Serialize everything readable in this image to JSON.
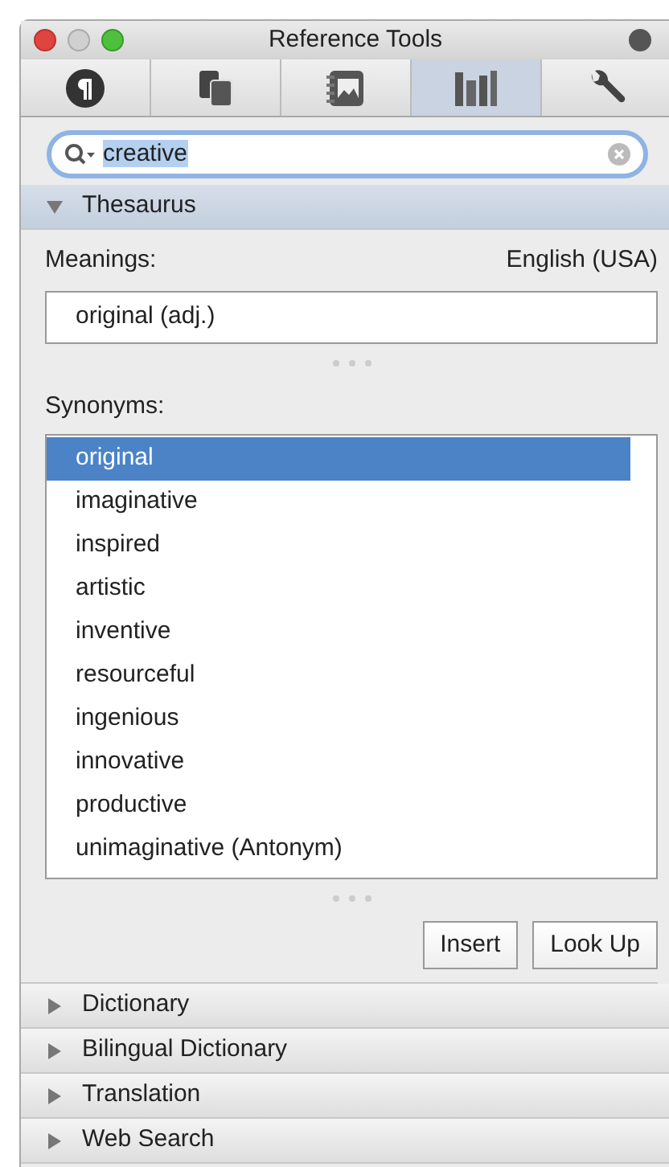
{
  "window": {
    "title": "Reference Tools"
  },
  "tabs": [
    {
      "kind": "paragraph",
      "selected": false
    },
    {
      "kind": "documents",
      "selected": false
    },
    {
      "kind": "media",
      "selected": false
    },
    {
      "kind": "library",
      "selected": true
    },
    {
      "kind": "tools",
      "selected": false
    }
  ],
  "search": {
    "value": "creative"
  },
  "sections": [
    {
      "title": "Thesaurus",
      "expanded": true
    },
    {
      "title": "Dictionary",
      "expanded": false
    },
    {
      "title": "Bilingual Dictionary",
      "expanded": false
    },
    {
      "title": "Translation",
      "expanded": false
    },
    {
      "title": "Web Search",
      "expanded": false
    }
  ],
  "thesaurus": {
    "meanings_label": "Meanings:",
    "language": "English (USA)",
    "meanings": [
      {
        "text": "original (adj.)",
        "selected": false
      }
    ],
    "synonyms_label": "Synonyms:",
    "synonyms": [
      {
        "text": "original",
        "selected": true
      },
      {
        "text": "imaginative",
        "selected": false
      },
      {
        "text": "inspired",
        "selected": false
      },
      {
        "text": "artistic",
        "selected": false
      },
      {
        "text": "inventive",
        "selected": false
      },
      {
        "text": "resourceful",
        "selected": false
      },
      {
        "text": "ingenious",
        "selected": false
      },
      {
        "text": "innovative",
        "selected": false
      },
      {
        "text": "productive",
        "selected": false
      },
      {
        "text": "unimaginative (Antonym)",
        "selected": false
      }
    ],
    "buttons": [
      "Insert",
      "Look Up"
    ]
  }
}
